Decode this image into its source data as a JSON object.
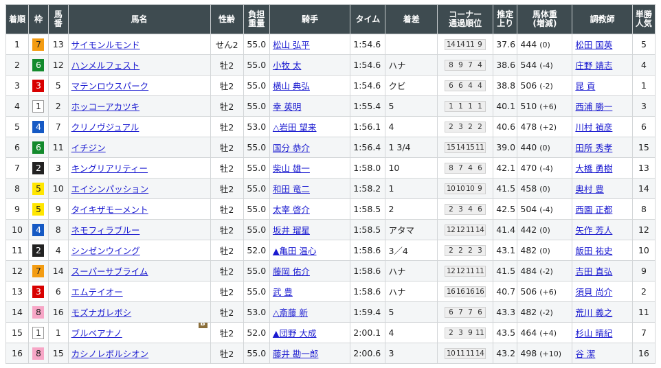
{
  "headers": {
    "rank": "着順",
    "waku": "枠",
    "umaban_l1": "馬",
    "umaban_l2": "番",
    "name": "馬名",
    "sex_age": "性齢",
    "weight_l1": "負担",
    "weight_l2": "重量",
    "jockey": "騎手",
    "time": "タイム",
    "margin": "着差",
    "corner_l1": "コーナー",
    "corner_l2": "通過順位",
    "last3f_l1": "推定",
    "last3f_l2": "上り",
    "body_l1": "馬体重",
    "body_l2": "(増減)",
    "trainer": "調教師",
    "pop_l1": "単勝",
    "pop_l2": "人気"
  },
  "rows": [
    {
      "rank": "1",
      "waku": "7",
      "umaban": "13",
      "name": "サイモンルモンド",
      "blinker": "",
      "sex_age": "せん2",
      "weight": "55.0",
      "jockey": "松山 弘平",
      "time": "1:54.6",
      "margin": "",
      "corners": [
        "14",
        "14",
        "11",
        "9"
      ],
      "last3f": "37.6",
      "body": "444",
      "body_diff": "(0)",
      "trainer": "松田 国英",
      "pop": "5"
    },
    {
      "rank": "2",
      "waku": "6",
      "umaban": "12",
      "name": "ハンメルフェスト",
      "blinker": "",
      "sex_age": "牡2",
      "weight": "55.0",
      "jockey": "小牧 太",
      "time": "1:54.6",
      "margin": "ハナ",
      "corners": [
        "8",
        "9",
        "7",
        "4"
      ],
      "last3f": "38.6",
      "body": "544",
      "body_diff": "(-4)",
      "trainer": "庄野 靖志",
      "pop": "4"
    },
    {
      "rank": "3",
      "waku": "3",
      "umaban": "5",
      "name": "マテンロウスパーク",
      "blinker": "",
      "sex_age": "牡2",
      "weight": "55.0",
      "jockey": "横山 典弘",
      "time": "1:54.6",
      "margin": "クビ",
      "corners": [
        "6",
        "6",
        "4",
        "4"
      ],
      "last3f": "38.8",
      "body": "506",
      "body_diff": "(-2)",
      "trainer": "昆 貢",
      "pop": "1"
    },
    {
      "rank": "4",
      "waku": "1",
      "umaban": "2",
      "name": "ホッコーアカツキ",
      "blinker": "",
      "sex_age": "牡2",
      "weight": "55.0",
      "jockey": "幸 英明",
      "time": "1:55.4",
      "margin": "5",
      "corners": [
        "1",
        "1",
        "1",
        "1"
      ],
      "last3f": "40.1",
      "body": "510",
      "body_diff": "(+6)",
      "trainer": "西浦 勝一",
      "pop": "3"
    },
    {
      "rank": "5",
      "waku": "4",
      "umaban": "7",
      "name": "クリノヴジュアル",
      "blinker": "",
      "sex_age": "牡2",
      "weight": "53.0",
      "jockey": "△岩田 望来",
      "time": "1:56.1",
      "margin": "4",
      "corners": [
        "2",
        "3",
        "2",
        "2"
      ],
      "last3f": "40.6",
      "body": "478",
      "body_diff": "(+2)",
      "trainer": "川村 禎彦",
      "pop": "6"
    },
    {
      "rank": "6",
      "waku": "6",
      "umaban": "11",
      "name": "イチジン",
      "blinker": "",
      "sex_age": "牡2",
      "weight": "55.0",
      "jockey": "国分 恭介",
      "time": "1:56.4",
      "margin": "1 3/4",
      "corners": [
        "15",
        "14",
        "15",
        "11"
      ],
      "last3f": "39.0",
      "body": "440",
      "body_diff": "(0)",
      "trainer": "田所 秀孝",
      "pop": "15"
    },
    {
      "rank": "7",
      "waku": "2",
      "umaban": "3",
      "name": "キングリアリティー",
      "blinker": "",
      "sex_age": "牡2",
      "weight": "55.0",
      "jockey": "柴山 雄一",
      "time": "1:58.0",
      "margin": "10",
      "corners": [
        "8",
        "7",
        "4",
        "6"
      ],
      "last3f": "42.1",
      "body": "470",
      "body_diff": "(-4)",
      "trainer": "大橋 勇樹",
      "pop": "13"
    },
    {
      "rank": "8",
      "waku": "5",
      "umaban": "10",
      "name": "エイシンパッション",
      "blinker": "",
      "sex_age": "牡2",
      "weight": "55.0",
      "jockey": "和田 竜二",
      "time": "1:58.2",
      "margin": "1",
      "corners": [
        "10",
        "10",
        "10",
        "9"
      ],
      "last3f": "41.5",
      "body": "458",
      "body_diff": "(0)",
      "trainer": "奥村 豊",
      "pop": "14"
    },
    {
      "rank": "9",
      "waku": "5",
      "umaban": "9",
      "name": "タイキザモーメント",
      "blinker": "",
      "sex_age": "牡2",
      "weight": "55.0",
      "jockey": "太宰 啓介",
      "time": "1:58.5",
      "margin": "2",
      "corners": [
        "2",
        "3",
        "4",
        "6"
      ],
      "last3f": "42.5",
      "body": "504",
      "body_diff": "(-4)",
      "trainer": "西園 正都",
      "pop": "8"
    },
    {
      "rank": "10",
      "waku": "4",
      "umaban": "8",
      "name": "ネモフィラブルー",
      "blinker": "",
      "sex_age": "牡2",
      "weight": "55.0",
      "jockey": "坂井 瑠星",
      "time": "1:58.5",
      "margin": "アタマ",
      "corners": [
        "12",
        "12",
        "11",
        "14"
      ],
      "last3f": "41.4",
      "body": "442",
      "body_diff": "(0)",
      "trainer": "矢作 芳人",
      "pop": "12"
    },
    {
      "rank": "11",
      "waku": "2",
      "umaban": "4",
      "name": "シンゼンウイング",
      "blinker": "",
      "sex_age": "牡2",
      "weight": "52.0",
      "jockey": "▲亀田 温心",
      "time": "1:58.6",
      "margin": "3／4",
      "corners": [
        "2",
        "2",
        "2",
        "3"
      ],
      "last3f": "43.1",
      "body": "482",
      "body_diff": "(0)",
      "trainer": "飯田 祐史",
      "pop": "10"
    },
    {
      "rank": "12",
      "waku": "7",
      "umaban": "14",
      "name": "スーパーサブライム",
      "blinker": "",
      "sex_age": "牡2",
      "weight": "55.0",
      "jockey": "藤岡 佑介",
      "time": "1:58.6",
      "margin": "ハナ",
      "corners": [
        "12",
        "12",
        "11",
        "11"
      ],
      "last3f": "41.5",
      "body": "484",
      "body_diff": "(-2)",
      "trainer": "吉田 直弘",
      "pop": "9"
    },
    {
      "rank": "13",
      "waku": "3",
      "umaban": "6",
      "name": "エムテイオー",
      "blinker": "",
      "sex_age": "牡2",
      "weight": "55.0",
      "jockey": "武 豊",
      "time": "1:58.6",
      "margin": "ハナ",
      "corners": [
        "16",
        "16",
        "16",
        "16"
      ],
      "last3f": "40.7",
      "body": "506",
      "body_diff": "(+6)",
      "trainer": "須貝 尚介",
      "pop": "2"
    },
    {
      "rank": "14",
      "waku": "8",
      "umaban": "16",
      "name": "モズナガレボシ",
      "blinker": "",
      "sex_age": "牡2",
      "weight": "53.0",
      "jockey": "△斎藤 新",
      "time": "1:59.4",
      "margin": "5",
      "corners": [
        "6",
        "7",
        "7",
        "6"
      ],
      "last3f": "43.3",
      "body": "482",
      "body_diff": "(-2)",
      "trainer": "荒川 義之",
      "pop": "11"
    },
    {
      "rank": "15",
      "waku": "1",
      "umaban": "1",
      "name": "ブルベアナノ",
      "blinker": "B",
      "sex_age": "牡2",
      "weight": "52.0",
      "jockey": "▲団野 大成",
      "time": "2:00.1",
      "margin": "4",
      "corners": [
        "2",
        "3",
        "9",
        "11"
      ],
      "last3f": "43.5",
      "body": "464",
      "body_diff": "(+4)",
      "trainer": "杉山 晴紀",
      "pop": "7"
    },
    {
      "rank": "16",
      "waku": "8",
      "umaban": "15",
      "name": "カシノレボルシオン",
      "blinker": "",
      "sex_age": "牡2",
      "weight": "55.0",
      "jockey": "藤井 勘一郎",
      "time": "2:00.6",
      "margin": "3",
      "corners": [
        "10",
        "11",
        "11",
        "14"
      ],
      "last3f": "43.2",
      "body": "498",
      "body_diff": "(+10)",
      "trainer": "谷 潔",
      "pop": "16"
    }
  ]
}
